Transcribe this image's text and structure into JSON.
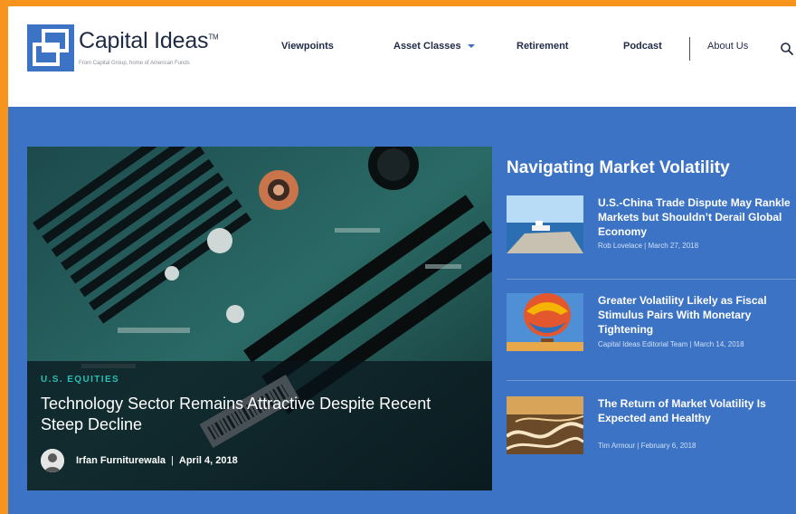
{
  "brand": {
    "name": "Capital Ideas",
    "trademark": "TM",
    "tagline": "From Capital Group, home of American Funds"
  },
  "nav": {
    "items": [
      {
        "label": "Viewpoints",
        "has_dropdown": false
      },
      {
        "label": "Asset Classes",
        "has_dropdown": true
      },
      {
        "label": "Retirement",
        "has_dropdown": false
      },
      {
        "label": "Podcast",
        "has_dropdown": false
      }
    ],
    "about": "About Us",
    "search_icon": "search-icon"
  },
  "feature": {
    "kicker": "U.S. EQUITIES",
    "title": "Technology Sector Remains Attractive Despite Recent Steep Decline",
    "author": "Irfan Furniturewala",
    "date": "April 4, 2018",
    "image": "circuit-board-photo"
  },
  "sidebar": {
    "heading": "Navigating Market Volatility",
    "items": [
      {
        "title": "U.S.-China Trade Dispute May Rankle Markets but Shouldn’t Derail Global Economy",
        "meta": "Rob Lovelace | March 27, 2018",
        "image": "cargo-ship-photo"
      },
      {
        "title": "Greater Volatility Likely as Fiscal Stimulus Pairs With Monetary Tightening",
        "meta": "Capital Ideas Editorial Team | March 14, 2018",
        "image": "hot-air-balloon-photo"
      },
      {
        "title": "The Return of Market Volatility Is Expected and Healthy",
        "meta": "Tim Armour | February 6, 2018",
        "image": "winding-road-photo"
      }
    ]
  },
  "colors": {
    "frame": "#f7941d",
    "section_blue": "#3d73c4",
    "navy_text": "#1f2a44",
    "kicker_teal": "#2bbfb3"
  }
}
